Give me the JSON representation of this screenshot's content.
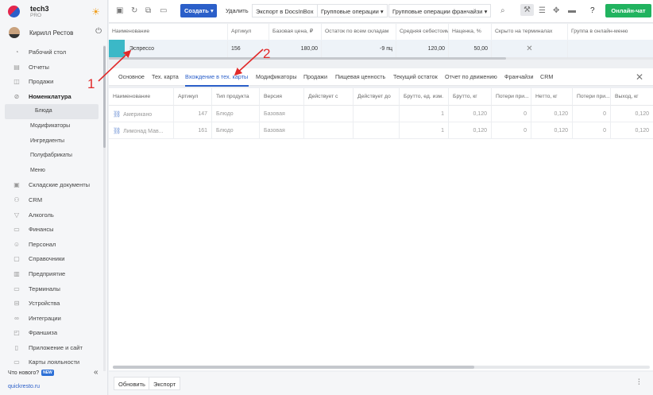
{
  "brand": {
    "name": "tech3",
    "plan": "PRO"
  },
  "user": {
    "name": "Кирилл Рестов"
  },
  "sidebar": {
    "items": [
      {
        "label": "Рабочий стол",
        "icon": "speedometer-icon"
      },
      {
        "label": "Отчеты",
        "icon": "chart-icon"
      },
      {
        "label": "Продажи",
        "icon": "cart-icon"
      },
      {
        "label": "Номенклатура",
        "icon": "tag-icon"
      },
      {
        "label": "Блюда",
        "icon": ""
      },
      {
        "label": "Модификаторы",
        "icon": ""
      },
      {
        "label": "Ингредиенты",
        "icon": ""
      },
      {
        "label": "Полуфабрикаты",
        "icon": ""
      },
      {
        "label": "Меню",
        "icon": ""
      },
      {
        "label": "Складские документы",
        "icon": "box-icon"
      },
      {
        "label": "CRM",
        "icon": "people-icon"
      },
      {
        "label": "Алкоголь",
        "icon": "glass-icon"
      },
      {
        "label": "Финансы",
        "icon": "wallet-icon"
      },
      {
        "label": "Персонал",
        "icon": "person-icon"
      },
      {
        "label": "Справочники",
        "icon": "book-icon"
      },
      {
        "label": "Предприятие",
        "icon": "building-icon"
      },
      {
        "label": "Терминалы",
        "icon": "terminal-icon"
      },
      {
        "label": "Устройства",
        "icon": "device-icon"
      },
      {
        "label": "Интеграции",
        "icon": "link-icon"
      },
      {
        "label": "Франшиза",
        "icon": "franchise-icon"
      },
      {
        "label": "Приложение и сайт",
        "icon": "phone-icon"
      },
      {
        "label": "Карты лояльности",
        "icon": "card-icon"
      }
    ],
    "whats_new": "Что нового?",
    "new_badge": "NEW",
    "site": "quickresto.ru"
  },
  "toolbar": {
    "create": "Создать",
    "delete": "Удалить",
    "export_docs": "Экспорт в DocsInBox",
    "group_ops": "Групповые операции",
    "group_ops_franchise": "Групповые операции франчайзи",
    "online_chat": "Онлайн-чат"
  },
  "main_table": {
    "headers": [
      "Наименование",
      "Артикул",
      "Базовая цена, ₽",
      "Остаток по всем складам",
      "Средняя себестоимость",
      "Наценка, %",
      "Скрыто на терминалах",
      "Группа в онлайн-меню"
    ],
    "row": {
      "name": "Эспрессо",
      "article": "156",
      "price": "180,00",
      "stock": "-9 пц",
      "cost": "120,00",
      "markup": "50,00",
      "hidden": "✕",
      "group": ""
    },
    "row_color": "#3bb8c7"
  },
  "tabs": [
    "Основное",
    "Тех. карта",
    "Вхождение в тех. карты",
    "Модификаторы",
    "Продажи",
    "Пищевая ценность",
    "Текущий остаток",
    "Отчет по движению",
    "Франчайзи",
    "CRM"
  ],
  "active_tab": "Вхождение в тех. карты",
  "sub_table": {
    "headers": [
      "Наименование",
      "Артикул",
      "Тип продукта",
      "Версия",
      "Действует с",
      "Действует до",
      "Брутто, ед. изм.",
      "Брутто, кг",
      "Потери при...",
      "Нетто, кг",
      "Потери при...",
      "Выход, кг"
    ],
    "rows": [
      {
        "name": "Американо",
        "article": "147",
        "type": "Блюдо",
        "version": "Базовая",
        "from": "",
        "to": "",
        "gross_unit": "1",
        "gross_kg": "0,120",
        "loss1": "0",
        "net": "0,120",
        "loss2": "0",
        "output": "0,120"
      },
      {
        "name": "Лимонад Мав...",
        "article": "161",
        "type": "Блюдо",
        "version": "Базовая",
        "from": "",
        "to": "",
        "gross_unit": "1",
        "gross_kg": "0,120",
        "loss1": "0",
        "net": "0,120",
        "loss2": "0",
        "output": "0,120"
      }
    ]
  },
  "footer": {
    "refresh": "Обновить",
    "export": "Экспорт"
  },
  "annotations": {
    "one": "1",
    "two": "2"
  },
  "colors": {
    "accent": "#2b5fc9",
    "online": "#21b35f",
    "annotation": "#e12a2a"
  }
}
